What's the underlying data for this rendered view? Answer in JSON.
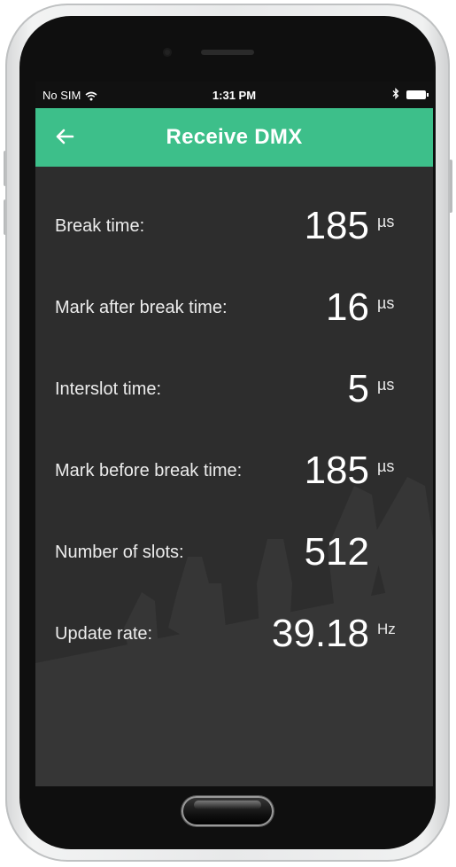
{
  "status_bar": {
    "carrier": "No SIM",
    "time": "1:31 PM",
    "wifi_icon": "wifi-icon",
    "bluetooth_icon": "bluetooth-icon",
    "battery_icon": "battery-icon"
  },
  "app_bar": {
    "title": "Receive DMX",
    "back_icon": "arrow-left-icon",
    "color": "#3dbf8a"
  },
  "metrics": [
    {
      "label": "Break time:",
      "value": "185",
      "unit": "µs"
    },
    {
      "label": "Mark after break time:",
      "value": "16",
      "unit": "µs"
    },
    {
      "label": "Interslot time:",
      "value": "5",
      "unit": "µs"
    },
    {
      "label": "Mark before break time:",
      "value": "185",
      "unit": "µs"
    },
    {
      "label": "Number of slots:",
      "value": "512",
      "unit": ""
    },
    {
      "label": "Update rate:",
      "value": "39.18",
      "unit": "Hz"
    }
  ],
  "theme": {
    "background": "#2d2d2d",
    "text": "#ffffff",
    "accent": "#3dbf8a"
  }
}
